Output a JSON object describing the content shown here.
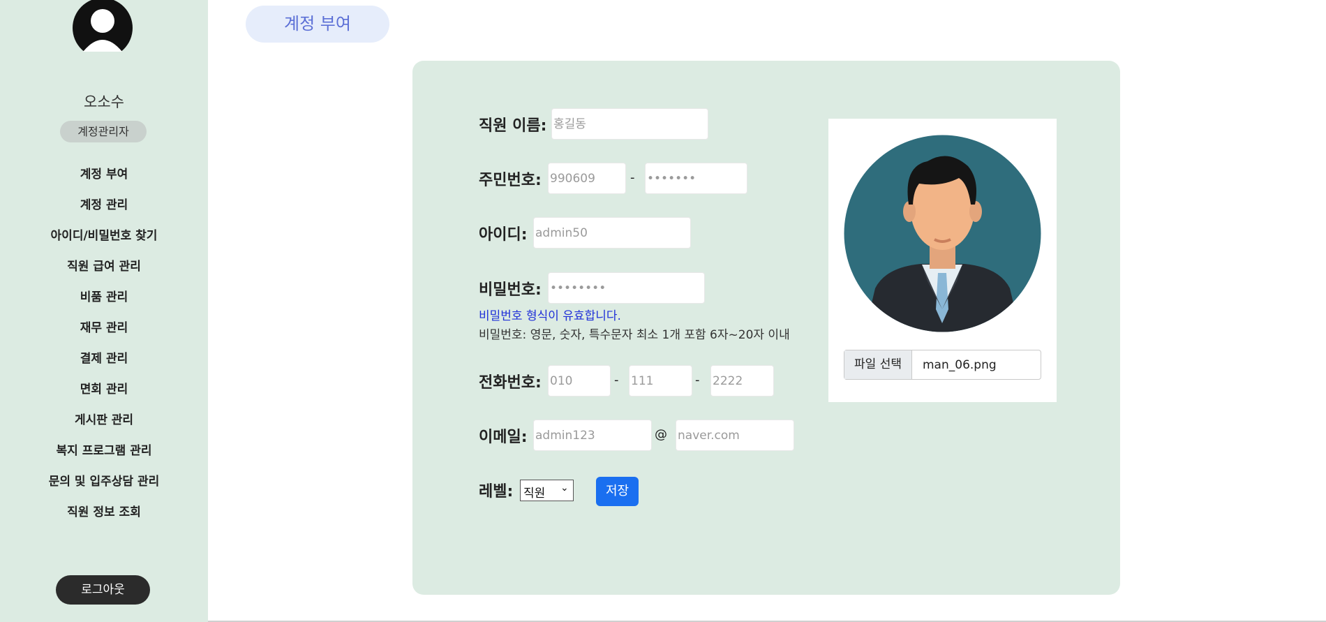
{
  "sidebar": {
    "user_name": "오소수",
    "role": "계정관리자",
    "items": [
      {
        "label": "계정 부여"
      },
      {
        "label": "계정 관리"
      },
      {
        "label": "아이디/비밀번호 찾기"
      },
      {
        "label": "직원 급여 관리"
      },
      {
        "label": "비품 관리"
      },
      {
        "label": "재무 관리"
      },
      {
        "label": "결제 관리"
      },
      {
        "label": "면회 관리"
      },
      {
        "label": "게시판 관리"
      },
      {
        "label": "복지 프로그램 관리"
      },
      {
        "label": "문의 및 입주상담 관리"
      },
      {
        "label": "직원 정보 조회"
      }
    ],
    "logout_label": "로그아웃"
  },
  "page": {
    "title": "계정 부여"
  },
  "form": {
    "name_label": "직원 이름:",
    "name_placeholder": "홍길동",
    "rrn_label": "주민번호:",
    "rrn_front_placeholder": "990609",
    "rrn_separator": "-",
    "rrn_back_value": "•••••••",
    "id_label": "아이디:",
    "id_placeholder": "admin50",
    "pw_label": "비밀번호:",
    "pw_value": "••••••••",
    "pw_valid_message": "비밀번호 형식이 유효합니다.",
    "pw_rule": "비밀번호: 영문, 숫자, 특수문자 최소 1개 포함 6자~20자 이내",
    "phone_label": "전화번호:",
    "phone_1_placeholder": "010",
    "phone_2_placeholder": "111",
    "phone_3_placeholder": "2222",
    "phone_separator": "-",
    "email_label": "이메일:",
    "email_user_placeholder": "admin123",
    "email_at": "@",
    "email_domain_placeholder": "naver.com",
    "level_label": "레벨:",
    "level_selected": "직원",
    "save_label": "저장"
  },
  "photo": {
    "file_button_label": "파일 선택",
    "file_name": "man_06.png"
  },
  "colors": {
    "panel_bg": "#dcebe2",
    "title_bg": "#e6edfb",
    "title_text": "#5b6fd6",
    "save_button": "#1a6ff0",
    "valid_text": "#2030d8",
    "avatar_bg": "#2f6d7c"
  }
}
